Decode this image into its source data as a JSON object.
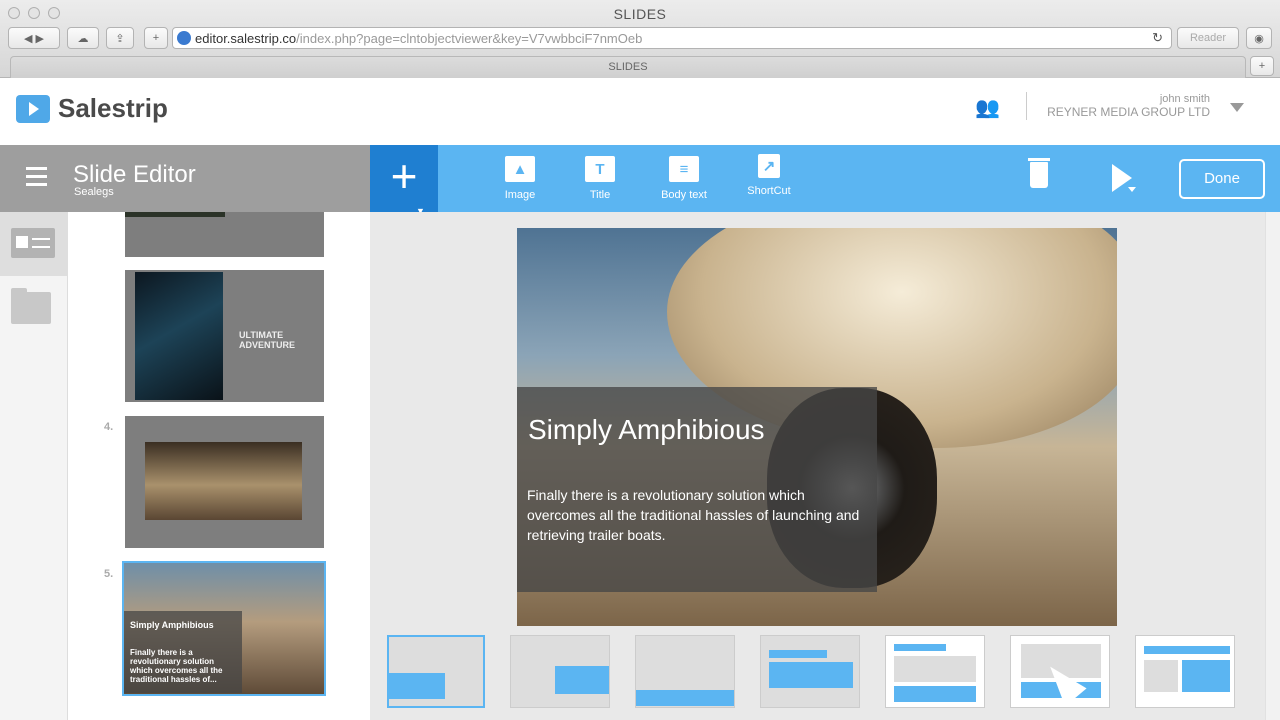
{
  "window": {
    "title": "SLIDES",
    "tab_title": "SLIDES"
  },
  "browser": {
    "url_host": "editor.salestrip.co",
    "url_path": "/index.php?page=clntobjectviewer&key=V7vwbbciF7nmOeb",
    "reader_label": "Reader"
  },
  "app": {
    "logo_text": "Salestrip"
  },
  "user": {
    "name": "john smith",
    "company": "REYNER MEDIA GROUP LTD"
  },
  "editor": {
    "title": "Slide Editor",
    "subtitle": "Sealegs"
  },
  "toolbar": {
    "items": [
      {
        "label": "Image",
        "icon": "image-icon"
      },
      {
        "label": "Title",
        "icon": "title-icon"
      },
      {
        "label": "Body text",
        "icon": "body-text-icon"
      },
      {
        "label": "ShortCut",
        "icon": "shortcut-icon"
      }
    ],
    "done_label": "Done"
  },
  "slides": [
    {
      "number": "",
      "caption": "ULTIMATE ADVENTURE"
    },
    {
      "number": "4.",
      "caption": ""
    },
    {
      "number": "5.",
      "title": "Simply Amphibious",
      "body": "Finally there is a revolutionary solution which overcomes all the traditional hassles of..."
    }
  ],
  "current_slide": {
    "title": "Simply Amphibious",
    "body": "Finally there is a revolutionary solution which overcomes all the traditional hassles of launching and retrieving trailer boats."
  },
  "colors": {
    "accent": "#5bb5f2",
    "accent_dark": "#1f7fd1",
    "header_gray": "#9e9e9e"
  }
}
